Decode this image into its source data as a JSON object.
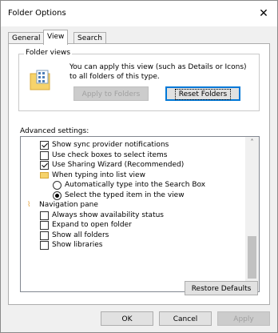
{
  "window": {
    "title": "Folder Options"
  },
  "tabs": [
    "General",
    "View",
    "Search"
  ],
  "folder_views": {
    "legend": "Folder views",
    "description": "You can apply this view (such as Details or Icons) to all folders of this type.",
    "apply_button": "Apply to Folders",
    "reset_button": "Reset Folders"
  },
  "advanced": {
    "label": "Advanced settings:",
    "items": [
      {
        "type": "checkbox",
        "checked": true,
        "label": "Show sync provider notifications"
      },
      {
        "type": "checkbox",
        "checked": false,
        "label": "Use check boxes to select items"
      },
      {
        "type": "checkbox",
        "checked": true,
        "label": "Use Sharing Wizard (Recommended)"
      },
      {
        "type": "folder",
        "label": "When typing into list view"
      },
      {
        "type": "radio",
        "checked": false,
        "label": "Automatically type into the Search Box"
      },
      {
        "type": "radio",
        "checked": true,
        "label": "Select the typed item in the view"
      },
      {
        "type": "nav",
        "label": "Navigation pane"
      },
      {
        "type": "checkbox",
        "checked": false,
        "label": "Always show availability status"
      },
      {
        "type": "checkbox",
        "checked": false,
        "label": "Expand to open folder"
      },
      {
        "type": "checkbox",
        "checked": false,
        "label": "Show all folders"
      },
      {
        "type": "checkbox",
        "checked": false,
        "label": "Show libraries"
      }
    ],
    "scroll_up": "˄",
    "scroll_down": "˅"
  },
  "buttons": {
    "restore": "Restore Defaults",
    "ok": "OK",
    "cancel": "Cancel",
    "apply": "Apply"
  },
  "close_glyph": "✕"
}
